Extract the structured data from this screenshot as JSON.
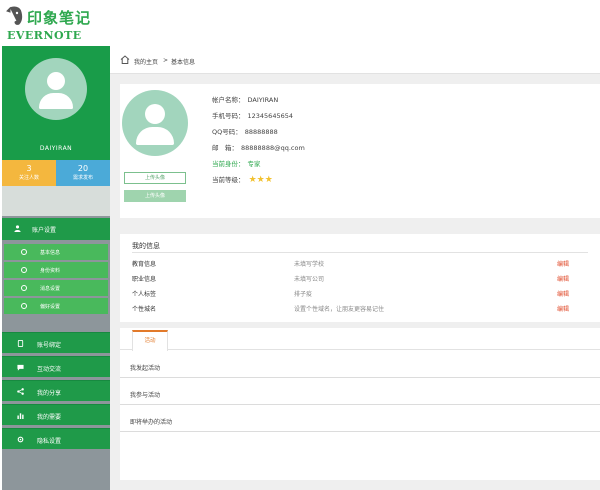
{
  "logo": {
    "cn": "印象笔记",
    "en": "EVERNOTE"
  },
  "sidebar": {
    "username": "DAIYIRAN",
    "stats": [
      {
        "num": "3",
        "label": "关注人数"
      },
      {
        "num": "20",
        "label": "需求发布"
      }
    ],
    "account_header": "账户设置",
    "sub_items": [
      "基本信息",
      "身份资料",
      "消息设置",
      "偏好设置"
    ],
    "menu": [
      "账号绑定",
      "互动交流",
      "我的分享",
      "我的需要",
      "隐私设置"
    ]
  },
  "breadcrumb": {
    "home": "我的主页",
    "sep": ">",
    "current": "基本信息"
  },
  "profile": {
    "upload_label": "上传头像",
    "upload2_label": "上传头像",
    "fields": [
      {
        "label": "帐户名称：",
        "value": "DAIYIRAN"
      },
      {
        "label": "手机号码：",
        "value": "12345645654"
      },
      {
        "label": "QQ号码：",
        "value": "88888888"
      },
      {
        "label": "邮　箱：",
        "value": "88888888@qq.com"
      },
      {
        "label": "当前身份：",
        "value": "专家"
      },
      {
        "label": "当前等级：",
        "value": ""
      }
    ],
    "stars": 3
  },
  "my_info": {
    "title": "我的信息",
    "rows": [
      {
        "label": "教育信息",
        "value": "未填写学校",
        "edit": "编辑"
      },
      {
        "label": "职业信息",
        "value": "未填写公司",
        "edit": "编辑"
      },
      {
        "label": "个人标签",
        "value": "排子疫",
        "edit": "编辑"
      },
      {
        "label": "个性城名",
        "value": "设置个性域名，让朋友更容易记住",
        "edit": "编辑"
      }
    ]
  },
  "activities": {
    "tab": "活动",
    "rows": [
      "我发起活动",
      "我参与活动",
      "即将举办的活动"
    ]
  },
  "colors": {
    "brand_green": "#199c49",
    "light_green": "#49b95c",
    "avatar_bg": "#a2d5bd",
    "follow_orange": "#f4b73e",
    "publish_blue": "#4baad8",
    "edit_red": "#e04a2a"
  }
}
